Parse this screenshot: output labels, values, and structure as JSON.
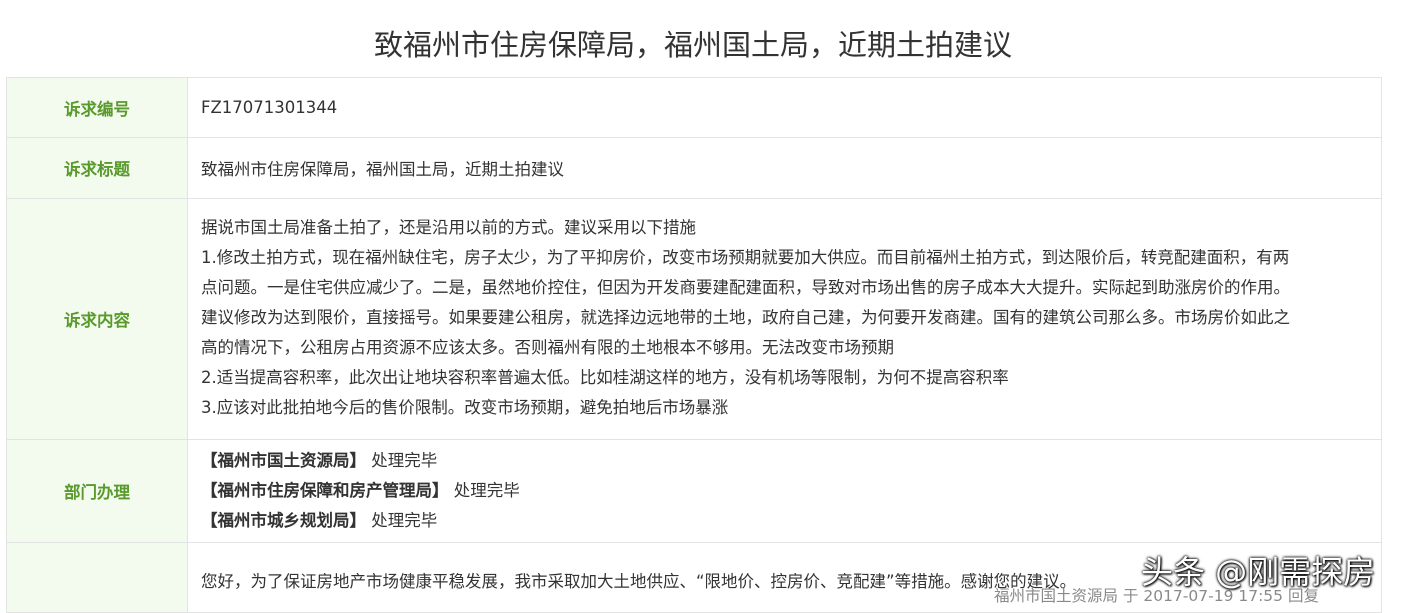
{
  "page_title": "致福州市住房保障局，福州国土局，近期土拍建议",
  "rows": {
    "id": {
      "label": "诉求编号",
      "value": "FZ17071301344"
    },
    "title": {
      "label": "诉求标题",
      "value": "致福州市住房保障局，福州国土局，近期土拍建议"
    },
    "content": {
      "label": "诉求内容",
      "lines": [
        "据说市国土局准备土拍了，还是沿用以前的方式。建议采用以下措施",
        "1.修改土拍方式，现在福州缺住宅，房子太少，为了平抑房价，改变市场预期就要加大供应。而目前福州土拍方式，到达限价后，转竞配建面积，有两",
        "点问题。一是住宅供应减少了。二是，虽然地价控住，但因为开发商要建配建面积，导致对市场出售的房子成本大大提升。实际起到助涨房价的作用。",
        "建议修改为达到限价，直接摇号。如果要建公租房，就选择边远地带的土地，政府自己建，为何要开发商建。国有的建筑公司那么多。市场房价如此之",
        "高的情况下，公租房占用资源不应该太多。否则福州有限的土地根本不够用。无法改变市场预期",
        "2.适当提高容积率，此次出让地块容积率普遍太低。比如桂湖这样的地方，没有机场等限制，为何不提高容积率",
        "3.应该对此批拍地今后的售价限制。改变市场预期，避免拍地后市场暴涨"
      ]
    },
    "departments": {
      "label": "部门办理",
      "items": [
        {
          "name": "【福州市国土资源局】",
          "status": "处理完毕"
        },
        {
          "name": "【福州市住房保障和房产管理局】",
          "status": "处理完毕"
        },
        {
          "name": "【福州市城乡规划局】",
          "status": "处理完毕"
        }
      ]
    },
    "reply": {
      "label": "",
      "text": "您好，为了保证房地产市场健康平稳发展，我市采取加大土地供应、“限地价、控房价、竞配建”等措施。感谢您的建议。",
      "meta": "福州市国土资源局 于 2017-07-19 17:55 回复"
    }
  },
  "watermark": "头条 @刚需探房",
  "colors": {
    "label_bg": "#f3fbee",
    "label_text": "#5a9a2c",
    "border": "#e3e3e3",
    "meta_text": "#8a8a8a"
  }
}
